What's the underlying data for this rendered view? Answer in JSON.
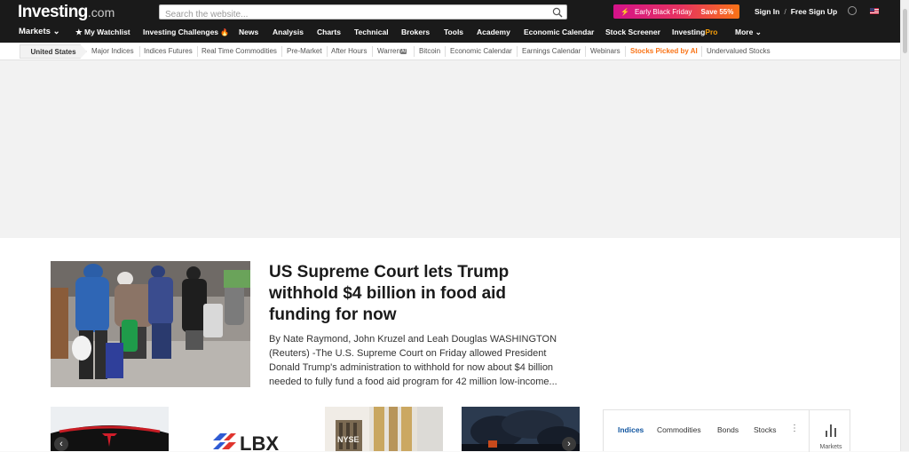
{
  "header": {
    "logo_main": "Investing",
    "logo_suffix": ".com",
    "search_placeholder": "Search the website...",
    "promo_text": "Early Black Friday",
    "promo_save": "Save 55%",
    "sign_in": "Sign In",
    "sign_sep": "/",
    "free_sign_up": "Free Sign Up"
  },
  "main_nav": {
    "markets": "Markets",
    "watchlist": "My Watchlist",
    "challenges": "Investing Challenges",
    "news": "News",
    "analysis": "Analysis",
    "charts": "Charts",
    "technical": "Technical",
    "brokers": "Brokers",
    "tools": "Tools",
    "academy": "Academy",
    "economic_calendar": "Economic Calendar",
    "stock_screener": "Stock Screener",
    "investing_pro_a": "Investing",
    "investing_pro_b": "Pro",
    "more": "More"
  },
  "sub_nav": {
    "region": "United States",
    "items": [
      "Major Indices",
      "Indices Futures",
      "Real Time Commodities",
      "Pre-Market",
      "After Hours",
      "Warren",
      "Bitcoin",
      "Economic Calendar",
      "Earnings Calendar",
      "Webinars",
      "Stocks Picked by AI",
      "Undervalued Stocks"
    ],
    "ai_badge": "AI"
  },
  "article": {
    "headline": "US Supreme Court lets Trump withhold $4 billion in food aid funding for now",
    "summary": "By Nate Raymond, John Kruzel and Leah Douglas WASHINGTON (Reuters) -The U.S. Supreme Court on Friday allowed President Donald Trump's administration to withhold for now about $4 billion needed to fully fund a food aid program for 42 million low-income..."
  },
  "thumb_texts": {
    "lbx": "LBX",
    "nyse": "NYSE"
  },
  "widget": {
    "tabs": [
      "Indices",
      "Commodities",
      "Bonds",
      "Stocks"
    ],
    "markets_label": "Markets"
  },
  "colors": {
    "header_bg": "#1a1a1a",
    "accent_orange": "#f97316",
    "active_tab": "#1256a0"
  }
}
